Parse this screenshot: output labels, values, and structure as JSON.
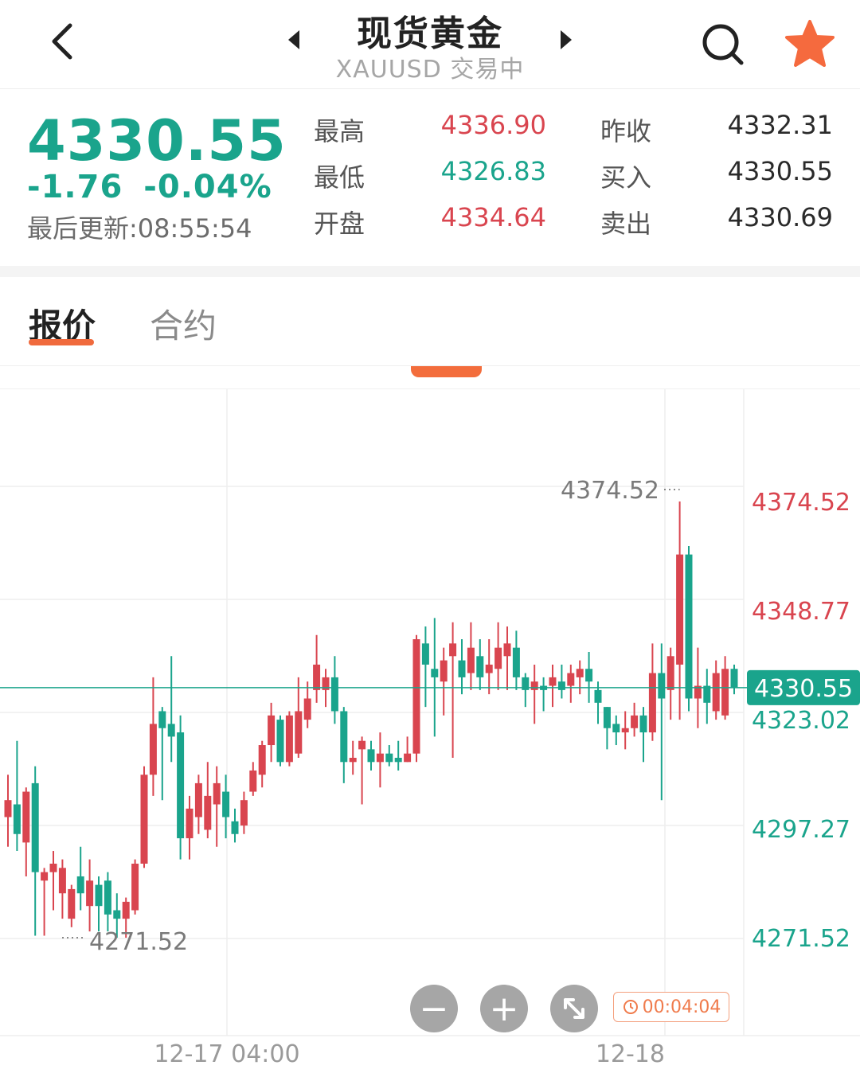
{
  "header": {
    "title": "现货黄金",
    "subtitle": "XAUUSD 交易中",
    "icons": [
      "back-icon",
      "prev-arrow-icon",
      "next-arrow-icon",
      "search-icon",
      "star-icon"
    ],
    "star_color": "#f56a3e"
  },
  "quote": {
    "price": "4330.55",
    "change": "-1.76",
    "change_pct": "-0.04%",
    "updated": "最后更新:08:55:54",
    "stats": [
      {
        "label": "最高",
        "value": "4336.90",
        "tone": "up"
      },
      {
        "label": "最低",
        "value": "4326.83",
        "tone": "down"
      },
      {
        "label": "开盘",
        "value": "4334.64",
        "tone": "up"
      },
      {
        "label": "昨收",
        "value": "4332.31",
        "tone": "neutral"
      },
      {
        "label": "买入",
        "value": "4330.55",
        "tone": "neutral"
      },
      {
        "label": "卖出",
        "value": "4330.69",
        "tone": "neutral"
      }
    ]
  },
  "tabs": [
    {
      "label": "报价",
      "active": true
    },
    {
      "label": "合约",
      "active": false
    }
  ],
  "colors": {
    "up": "#d9454f",
    "down": "#1aa48c",
    "accent": "#f36d3c",
    "current_price_bg": "#1aa48c"
  },
  "controls": {
    "zoom_out": "−",
    "zoom_in": "+",
    "timer": "00:04:04"
  },
  "chart_data": {
    "type": "candlestick",
    "y_axis_labels": [
      "4374.52",
      "4348.77",
      "4323.02",
      "4297.27",
      "4271.52"
    ],
    "current_price_label": "4330.55",
    "max_marker": "4374.52",
    "min_marker": "4271.52",
    "x_tick_labels": [
      "12-17 04:00",
      "12-18"
    ],
    "ylim": [
      4262,
      4383
    ],
    "candles": [
      [
        4300,
        4304,
        4310,
        4293
      ],
      [
        4303,
        4296,
        4318,
        4292
      ],
      [
        4294,
        4306,
        4307,
        4286
      ],
      [
        4308,
        4287,
        4312,
        4272
      ],
      [
        4285,
        4287,
        4288,
        4272
      ],
      [
        4287,
        4289,
        4292,
        4278
      ],
      [
        4282,
        4288,
        4290,
        4276
      ],
      [
        4276,
        4283,
        4284,
        4274
      ],
      [
        4286,
        4282,
        4293,
        4278
      ],
      [
        4279,
        4285,
        4290,
        4273
      ],
      [
        4284,
        4279,
        4286,
        4273
      ],
      [
        4285,
        4277,
        4287,
        4273
      ],
      [
        4278,
        4276,
        4282,
        4271.52
      ],
      [
        4276,
        4280,
        4281,
        4271.52
      ],
      [
        4278,
        4289,
        4290,
        4277
      ],
      [
        4289,
        4310,
        4312,
        4288
      ],
      [
        4310,
        4322,
        4333,
        4305
      ],
      [
        4325,
        4321,
        4326,
        4304
      ],
      [
        4322,
        4319,
        4338,
        4313
      ],
      [
        4320,
        4295,
        4324,
        4290
      ],
      [
        4295,
        4302,
        4305,
        4290
      ],
      [
        4300,
        4308,
        4310,
        4296
      ],
      [
        4297,
        4305,
        4313,
        4295
      ],
      [
        4303,
        4308,
        4312,
        4293
      ],
      [
        4306,
        4300,
        4310,
        4295
      ],
      [
        4299,
        4296,
        4302,
        4294
      ],
      [
        4298,
        4304,
        4306,
        4296
      ],
      [
        4306,
        4311,
        4313,
        4305
      ],
      [
        4310,
        4317,
        4318,
        4307
      ],
      [
        4317,
        4324,
        4327,
        4313
      ],
      [
        4323,
        4313,
        4324,
        4312
      ],
      [
        4313,
        4324,
        4325,
        4312
      ],
      [
        4315,
        4325,
        4333,
        4314
      ],
      [
        4323,
        4328,
        4332,
        4321
      ],
      [
        4330,
        4336,
        4343,
        4327
      ],
      [
        4330,
        4333,
        4335,
        4326
      ],
      [
        4333,
        4325,
        4338,
        4322
      ],
      [
        4325,
        4313,
        4326,
        4308
      ],
      [
        4313,
        4314,
        4318,
        4310
      ],
      [
        4316,
        4318,
        4319,
        4303
      ],
      [
        4316,
        4313,
        4318,
        4311
      ],
      [
        4313,
        4315,
        4320,
        4307
      ],
      [
        4315,
        4313,
        4317,
        4312
      ],
      [
        4314,
        4313,
        4318,
        4311
      ],
      [
        4313,
        4315,
        4319,
        4313
      ],
      [
        4315,
        4342,
        4343,
        4313
      ],
      [
        4341,
        4336,
        4345,
        4326
      ],
      [
        4335,
        4333,
        4347,
        4319
      ],
      [
        4332,
        4337,
        4340,
        4324
      ],
      [
        4338,
        4341,
        4346,
        4314
      ],
      [
        4337,
        4333,
        4342,
        4329
      ],
      [
        4334,
        4340,
        4346,
        4330
      ],
      [
        4338,
        4333,
        4342,
        4330
      ],
      [
        4334,
        4336,
        4342,
        4329
      ],
      [
        4335,
        4340,
        4346,
        4330
      ],
      [
        4338,
        4341,
        4345,
        4330
      ],
      [
        4340,
        4333,
        4344,
        4330
      ],
      [
        4333,
        4330,
        4334,
        4326
      ],
      [
        4330,
        4332,
        4336,
        4322
      ],
      [
        4331,
        4330,
        4333,
        4325
      ],
      [
        4331,
        4333,
        4336,
        4326
      ],
      [
        4332,
        4330,
        4336,
        4328
      ],
      [
        4331,
        4334,
        4336,
        4327
      ],
      [
        4333,
        4335,
        4337,
        4329
      ],
      [
        4335,
        4332,
        4339,
        4327
      ],
      [
        4330,
        4327,
        4332,
        4322
      ],
      [
        4326,
        4321,
        4326,
        4316
      ],
      [
        4322,
        4320,
        4324,
        4317
      ],
      [
        4320,
        4321,
        4325,
        4316
      ],
      [
        4321,
        4324,
        4327,
        4319
      ],
      [
        4324,
        4320,
        4326,
        4313
      ],
      [
        4320,
        4334,
        4341,
        4318
      ],
      [
        4334,
        4328,
        4341,
        4304
      ],
      [
        4330,
        4338,
        4340,
        4323
      ],
      [
        4336,
        4362,
        4374.52,
        4323
      ],
      [
        4362,
        4328,
        4364,
        4325
      ],
      [
        4328,
        4331,
        4340,
        4321
      ],
      [
        4331,
        4327,
        4335,
        4322
      ],
      [
        4325,
        4334,
        4337,
        4323
      ],
      [
        4324,
        4335,
        4338,
        4323
      ],
      [
        4335,
        4330.55,
        4336,
        4329
      ]
    ]
  }
}
